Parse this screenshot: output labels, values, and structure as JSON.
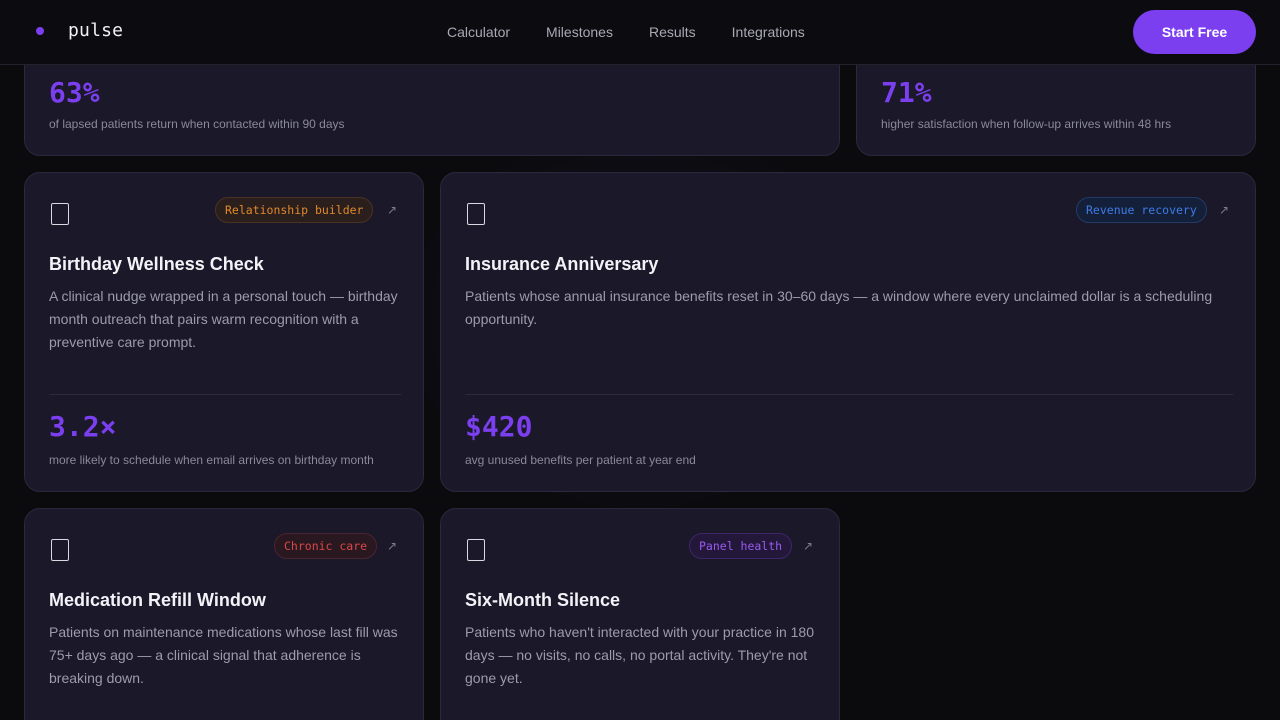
{
  "nav": {
    "brand": "pulse",
    "links": [
      "Calculator",
      "Milestones",
      "Results",
      "Integrations"
    ],
    "cta": "Start Free"
  },
  "stats": [
    {
      "value": "63%",
      "label": "of lapsed patients return when contacted within 90 days"
    },
    {
      "value": "71%",
      "label": "higher satisfaction when follow-up arrives within 48 hrs"
    }
  ],
  "cards": [
    {
      "icon": "document-icon",
      "tag": "Relationship builder",
      "tag_color": "#e0882c",
      "title": "Birthday Wellness Check",
      "desc": "A clinical nudge wrapped in a personal touch — birthday month outreach that pairs warm recognition with a preventive care prompt.",
      "metric": "3.2×",
      "metric_label": "more likely to schedule when email arrives on birthday month"
    },
    {
      "icon": "document-icon",
      "tag": "Revenue recovery",
      "tag_color": "#3f7be6",
      "title": "Insurance Anniversary",
      "desc": "Patients whose annual insurance benefits reset in 30–60 days — a window where every unclaimed dollar is a scheduling opportunity.",
      "metric": "$420",
      "metric_label": "avg unused benefits per patient at year end"
    },
    {
      "icon": "document-icon",
      "tag": "Chronic care",
      "tag_color": "#d84848",
      "title": "Medication Refill Window",
      "desc": "Patients on maintenance medications whose last fill was 75+ days ago — a clinical signal that adherence is breaking down."
    },
    {
      "icon": "document-icon",
      "tag": "Panel health",
      "tag_color": "#9a5af0",
      "title": "Six-Month Silence",
      "desc": "Patients who haven't interacted with your practice in 180 days — no visits, no calls, no portal activity. They're not gone yet."
    }
  ],
  "colors": {
    "accent": "#7b3ff0",
    "background": "#0b0b0e",
    "card": "#1a1829"
  }
}
